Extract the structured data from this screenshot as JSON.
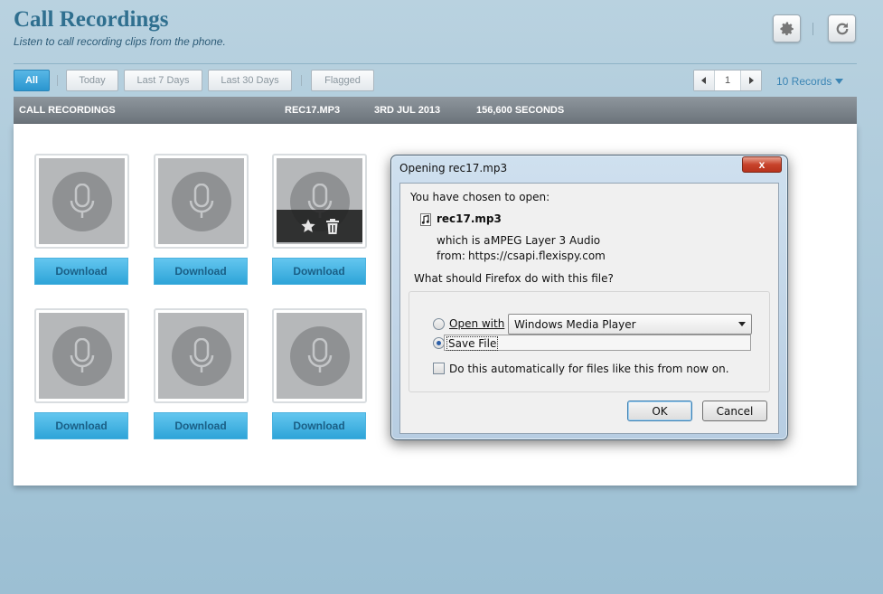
{
  "header": {
    "title": "Call Recordings",
    "subtitle": "Listen to call recording clips from the phone.",
    "settings_icon": "gear-icon",
    "refresh_icon": "refresh-icon"
  },
  "filters": [
    {
      "label": "All",
      "active": true
    },
    {
      "label": "Today",
      "active": false
    },
    {
      "label": "Last 7 Days",
      "active": false
    },
    {
      "label": "Last 30 Days",
      "active": false
    },
    {
      "label": "Flagged",
      "active": false
    }
  ],
  "pager": {
    "page": "1",
    "records_label": "10 Records"
  },
  "table_header": {
    "section": "CALL RECORDINGS",
    "file": "REC17.MP3",
    "date": "3RD JUL 2013",
    "duration": "156,600 SECONDS"
  },
  "recordings": [
    {
      "download_label": "Download"
    },
    {
      "download_label": "Download"
    },
    {
      "download_label": "Download",
      "hovered": true
    },
    {
      "download_label": "Download"
    },
    {
      "download_label": "Download"
    },
    {
      "download_label": "Download"
    }
  ],
  "dialog": {
    "title": "Opening rec17.mp3",
    "close_label": "x",
    "intro": "You have chosen to open:",
    "filename": "rec17.mp3",
    "which_is_label": "which is a:",
    "which_is_value": "MPEG Layer 3 Audio",
    "from_label": "from:",
    "from_value": "https://csapi.flexispy.com",
    "question": "What should Firefox do with this file?",
    "open_with_label": "Open with",
    "open_with_value": "Windows Media Player",
    "save_file_label": "Save File",
    "selected_option": "save_file",
    "auto_label": "Do this automatically for files like this from now on.",
    "auto_checked": false,
    "ok_label": "OK",
    "cancel_label": "Cancel"
  },
  "colors": {
    "accent": "#2b96cf",
    "title": "#2f6f8f",
    "download": "#2ea4d8"
  }
}
